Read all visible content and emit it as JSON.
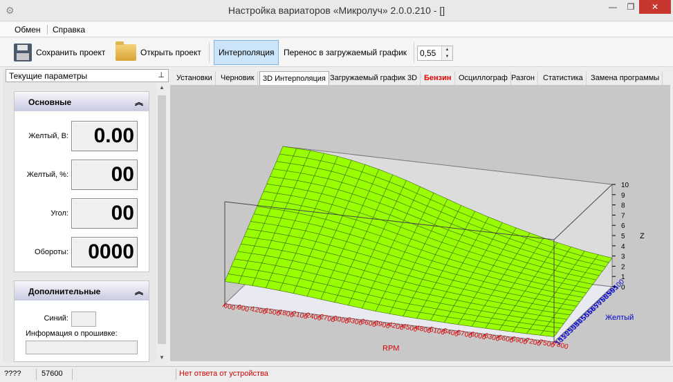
{
  "window": {
    "title": "Настройка вариаторов «Микролуч» 2.0.0.210 - []"
  },
  "menu": {
    "items": [
      "Обмен",
      "Справка"
    ]
  },
  "toolbar": {
    "save_label": "Сохранить проект",
    "open_label": "Открыть проект",
    "interp_label": "Интерполяция",
    "transfer_label": "Перенос в загружаемый график",
    "spin_value": "0,55"
  },
  "left_panel": {
    "header": "Текущие параметры",
    "group_main": {
      "title": "Основные",
      "fields": [
        {
          "label": "Желтый, В:",
          "value": "0.00"
        },
        {
          "label": "Желтый, %:",
          "value": "00"
        },
        {
          "label": "Угол:",
          "value": "00"
        },
        {
          "label": "Обороты:",
          "value": "0000"
        }
      ]
    },
    "group_extra": {
      "title": "Дополнительные",
      "blue_label": "Синий:",
      "firmware_label": "Информация о прошивке:"
    }
  },
  "tabs": [
    {
      "label": "Установки",
      "active": false,
      "red": false
    },
    {
      "label": "Черновик",
      "active": false,
      "red": false
    },
    {
      "label": "3D Интерполяция",
      "active": true,
      "red": false
    },
    {
      "label": "Загружаемый график 3D",
      "active": false,
      "red": false
    },
    {
      "label": "Бензин",
      "active": false,
      "red": true
    },
    {
      "label": "Осциллограф",
      "active": false,
      "red": false
    },
    {
      "label": "Разгон",
      "active": false,
      "red": false
    },
    {
      "label": "Статистика",
      "active": false,
      "red": false
    },
    {
      "label": "Замена программы",
      "active": false,
      "red": false
    }
  ],
  "chart_data": {
    "type": "surface",
    "x_axis": {
      "label": "RPM",
      "min": 600,
      "max": 7800,
      "step": 300
    },
    "y_axis": {
      "label": "Желтый",
      "min": 10,
      "max": 100,
      "step": 5
    },
    "z_axis": {
      "label": "Z",
      "min": 0,
      "max": 10,
      "ticks": [
        0,
        1,
        2,
        3,
        4,
        5,
        6,
        7,
        8,
        9,
        10
      ]
    },
    "surface_color": "#99ff00",
    "x_tick_color": "#d40000",
    "y_tick_color": "#0000cc",
    "z_front_edge": [
      2.2,
      2.1,
      1.9,
      1.6,
      1.3,
      1.0,
      0.8,
      0.7,
      0.6,
      0.55,
      0.5,
      0.5
    ],
    "z_back_edge": [
      10,
      9.9,
      9.6,
      9.0,
      8.2,
      7.2,
      6.2,
      5.3,
      4.5,
      3.8,
      3.2,
      2.8
    ]
  },
  "status": {
    "cell1": "????",
    "cell2": "57600",
    "message": "Нет ответа от устройства",
    "message_color": "#d40000"
  }
}
